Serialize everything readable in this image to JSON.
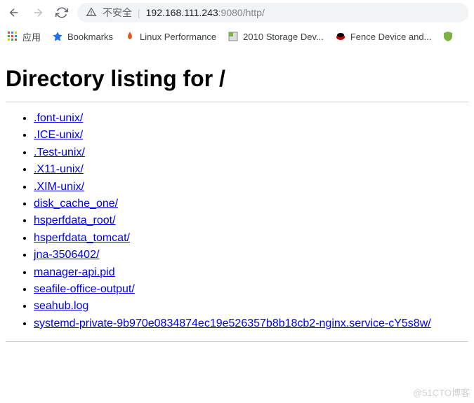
{
  "browser": {
    "insecure_label": "不安全",
    "url_host": "192.168.111.243",
    "url_port_path": ":9080/http/"
  },
  "bookmarks": {
    "apps_label": "应用",
    "items": [
      {
        "label": "Bookmarks"
      },
      {
        "label": "Linux Performance"
      },
      {
        "label": "2010 Storage Dev..."
      },
      {
        "label": "Fence Device and..."
      }
    ]
  },
  "page": {
    "title": "Directory listing for /",
    "entries": [
      ".font-unix/",
      ".ICE-unix/",
      ".Test-unix/",
      ".X11-unix/",
      ".XIM-unix/",
      "disk_cache_one/",
      "hsperfdata_root/",
      "hsperfdata_tomcat/",
      "jna-3506402/",
      "manager-api.pid",
      "seafile-office-output/",
      "seahub.log",
      "systemd-private-9b970e0834874ec19e526357b8b18cb2-nginx.service-cY5s8w/"
    ]
  },
  "watermark": "@51CTO博客"
}
